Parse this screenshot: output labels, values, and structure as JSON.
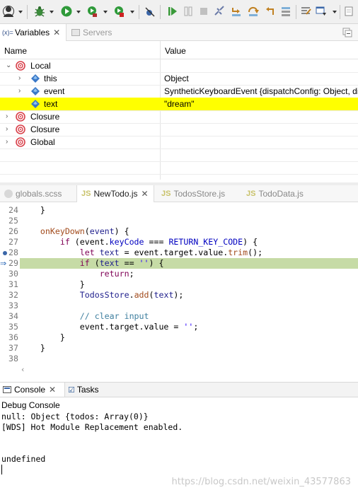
{
  "toolbar": {
    "icons": [
      "avatar-icon",
      "dropdown",
      "debug-icon",
      "dropdown",
      "run-icon",
      "dropdown",
      "run-coverage-icon",
      "dropdown",
      "stop-icon",
      "dropdown",
      "skip-breakpoints-icon",
      "resume-icon",
      "suspend-icon",
      "terminate-icon",
      "disconnect-icon",
      "step-into-icon",
      "step-over-icon",
      "step-return-icon",
      "drop-to-frame-icon",
      "use-step-filters-icon",
      "open-perspective-icon",
      "show-view-icon",
      "new-window-icon"
    ]
  },
  "variables_view": {
    "tabs": [
      {
        "prefix": "(x)=",
        "label": "Variables",
        "active": true
      },
      {
        "label": "Servers",
        "active": false
      }
    ],
    "columns": {
      "name": "Name",
      "value": "Value"
    },
    "rows": [
      {
        "name": "Local",
        "value": "",
        "expanded": true,
        "level": 0
      },
      {
        "name": "this",
        "value": "Object",
        "level": 1
      },
      {
        "name": "event",
        "value": "SyntheticKeyboardEvent {dispatchConfig: Object, dis",
        "level": 1
      },
      {
        "name": "text",
        "value": "\"dream\"",
        "level": 1,
        "selected": true
      },
      {
        "name": "Closure",
        "value": "",
        "level": 0
      },
      {
        "name": "Closure",
        "value": "",
        "level": 0
      },
      {
        "name": "Global",
        "value": "",
        "level": 0
      }
    ],
    "selected_color": "#ffff00"
  },
  "editor": {
    "tabs": [
      {
        "label": "globals.scss",
        "type": "scss",
        "active": false
      },
      {
        "label": "NewTodo.js",
        "type": "js",
        "active": true
      },
      {
        "label": "TodosStore.js",
        "type": "js",
        "active": false
      },
      {
        "label": "TodoData.js",
        "type": "js",
        "active": false
      }
    ],
    "js_badge": "JS",
    "lines": [
      {
        "num": "24",
        "text": "    }"
      },
      {
        "num": "25",
        "text": ""
      },
      {
        "num": "26",
        "text": "    onKeyDown(event) {"
      },
      {
        "num": "27",
        "text": "        if (event.keyCode === RETURN_KEY_CODE) {"
      },
      {
        "num": "28",
        "text": "            let text = event.target.value.trim();",
        "breakpoint": true
      },
      {
        "num": "29",
        "text": "            if (text == '') {",
        "current": true,
        "breakpoint": true
      },
      {
        "num": "30",
        "text": "                return;"
      },
      {
        "num": "31",
        "text": "            }"
      },
      {
        "num": "32",
        "text": "            TodosStore.add(text);"
      },
      {
        "num": "33",
        "text": ""
      },
      {
        "num": "34",
        "text": "            // clear input"
      },
      {
        "num": "35",
        "text": "            event.target.value = '';"
      },
      {
        "num": "36",
        "text": "        }"
      },
      {
        "num": "37",
        "text": "    }"
      },
      {
        "num": "38",
        "text": ""
      }
    ],
    "highlight_color": "#c6dba6"
  },
  "console_view": {
    "tabs": [
      {
        "label": "Console",
        "active": true
      },
      {
        "label": "Tasks",
        "active": false
      }
    ],
    "title": "Debug Console",
    "output": [
      "null: Object {todos: Array(0)}",
      "[WDS] Hot Module Replacement enabled.",
      "",
      "",
      "undefined"
    ]
  },
  "watermark": "https://blog.csdn.net/weixin_43577863"
}
